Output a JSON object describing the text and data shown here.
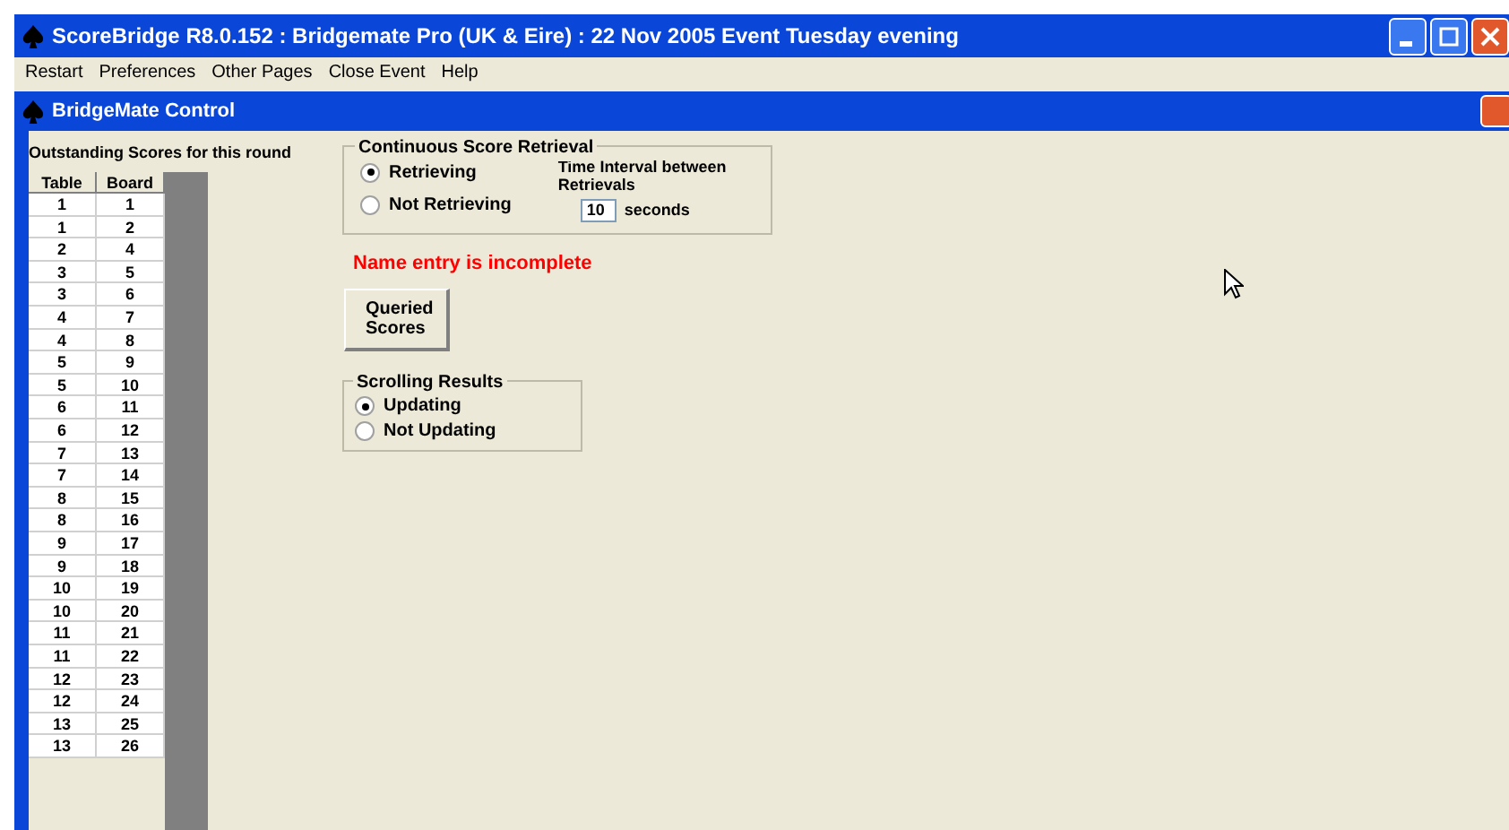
{
  "window": {
    "title": "ScoreBridge R8.0.152 : Bridgemate Pro (UK & Eire) : 22 Nov 2005 Event Tuesday evening"
  },
  "menu": [
    "Restart",
    "Preferences",
    "Other Pages",
    "Close Event",
    "Help"
  ],
  "child_window": {
    "title": "BridgeMate Control"
  },
  "outstanding": {
    "heading": "Outstanding Scores for this round",
    "columns": [
      "Table",
      "Board"
    ],
    "rows": [
      [
        "1",
        "1"
      ],
      [
        "1",
        "2"
      ],
      [
        "2",
        "4"
      ],
      [
        "3",
        "5"
      ],
      [
        "3",
        "6"
      ],
      [
        "4",
        "7"
      ],
      [
        "4",
        "8"
      ],
      [
        "5",
        "9"
      ],
      [
        "5",
        "10"
      ],
      [
        "6",
        "11"
      ],
      [
        "6",
        "12"
      ],
      [
        "7",
        "13"
      ],
      [
        "7",
        "14"
      ],
      [
        "8",
        "15"
      ],
      [
        "8",
        "16"
      ],
      [
        "9",
        "17"
      ],
      [
        "9",
        "18"
      ],
      [
        "10",
        "19"
      ],
      [
        "10",
        "20"
      ],
      [
        "11",
        "21"
      ],
      [
        "11",
        "22"
      ],
      [
        "12",
        "23"
      ],
      [
        "12",
        "24"
      ],
      [
        "13",
        "25"
      ],
      [
        "13",
        "26"
      ]
    ]
  },
  "retrieval": {
    "title": "Continuous Score Retrieval",
    "options": [
      {
        "label": "Retrieving",
        "selected": true
      },
      {
        "label": "Not Retrieving",
        "selected": false
      }
    ],
    "interval_label": "Time Interval between Retrievals",
    "interval_value": "10",
    "interval_unit": "seconds"
  },
  "warning": "Name entry is incomplete",
  "queried_button": "Queried Scores",
  "scrolling": {
    "title": "Scrolling Results",
    "options": [
      {
        "label": "Updating",
        "selected": true
      },
      {
        "label": "Not Updating",
        "selected": false
      }
    ]
  }
}
